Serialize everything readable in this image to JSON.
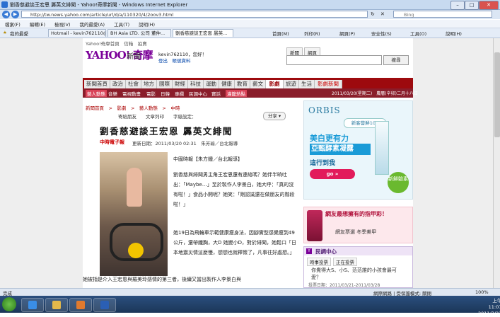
{
  "window": {
    "title": "劉香慈避談王宏恩 羼英文緋聞 - Yahoo!奇摩新聞 - Windows Internet Explorer",
    "min": "–",
    "max": "□",
    "close": "✕"
  },
  "address": {
    "url": "http://tw.news.yahoo.com/article/url/d/a/110320/4/2oov3.html",
    "search_placeholder": "Bing"
  },
  "menu": [
    "檔案(F)",
    "編輯(E)",
    "檢視(V)",
    "我的最愛(A)",
    "工具(T)",
    "說明(H)"
  ],
  "favbar": {
    "favorites": "我的最愛",
    "tabs": [
      "Hotmail - kevin762110@...",
      "BH Asia LTD. 公司 董仲...",
      "劉香慈避談王宏恩 羼英..."
    ],
    "commands": [
      "首頁(M)",
      "列印(R)",
      "網頁(P)",
      "安全性(S)",
      "工具(O)",
      "說明(H)"
    ]
  },
  "site": {
    "toplinks": "Yahoo!奇摩首頁　信箱　拍賣",
    "logo": "YAHOO! 奇摩",
    "logo_sub": "新聞",
    "user": "kevin762110，您好！",
    "user_links": "登出　帳號資料",
    "search_tabs": [
      "新聞",
      "網頁"
    ],
    "search_button": "搜尋"
  },
  "categories": [
    "新聞首頁",
    "政治",
    "社會",
    "地方",
    "國際",
    "財經",
    "科技",
    "運動",
    "健康",
    "教育",
    "藝文",
    "影劇",
    "旅遊",
    "生活",
    "影劇新聞"
  ],
  "subnav": {
    "items": [
      "藝人動態",
      "音樂",
      "電視動畫",
      "電影",
      "日韓",
      "專欄",
      "民調中心",
      "寶話",
      "灌籠熱點"
    ],
    "date": "2011/03/20(星期二)　農曆(辛卯)二月十八日"
  },
  "breadcrumb": "新聞首頁　>　影劇　>　藝人動態　>　中時",
  "tools": {
    "items": "寄給朋友　　文章列印　　字級設定：",
    "share": "分享 ▾"
  },
  "article": {
    "headline": "劉香慈避談王宏恩 羼英文緋聞",
    "source": "中時電子報",
    "dateline": "更新日期：2011/03/20 02:31　朱芳瑜／台北報導",
    "paragraphs": [
      "中國時報【朱方鍾／台北報導】",
      "劉香慈與緋聞男主角王宏恩還有連絡嗎？她伴半晌吐出：「Maybe…」至於製作人李景白，她大呼：「真的沒有啦！」食品小開呢？她笑：「剛認識還在做朋友的階段啦！」",
      "她19日為飛輪車示範健康瘦身法，因腳實型感覺瘦到49公斤，還帶纖胸，大D 她變小D，對於緋聞，她鬆口「日本地震災情這麼慢，想想也就釋懷了，凡事往好處想。」",
      "她被指是介入王宏恩與羅美玲感情的第三者，後續又當出製作人李景白與"
    ],
    "link_words": [
      "瘦身",
      "地震",
      "第三者"
    ]
  },
  "ads": {
    "brand": "ORBIS",
    "pill": "新客嘗鮮100",
    "line1": "美白更有力",
    "line2": "亞甄酵素凝露",
    "line3": "這行到我",
    "go": "go »",
    "badge": "新鮮驗素",
    "ad2_q": "網友最想擁有的指甲彩！",
    "ad2_l2": "網友票選 冬季美甲"
  },
  "poll": {
    "title": "民調中心",
    "tabs": [
      "時事投票",
      "正在投票"
    ],
    "question": "你覺得大S、小S、范范誰的小孩會最可愛？",
    "meta": "投票日期：2011/03/21-2011/03/28"
  },
  "status": {
    "left": "完成",
    "zone": "網際網路 | 受保護模式: 關閉",
    "zoom": "100%"
  },
  "clock": {
    "time": "上午 11:07",
    "date": "2011/3/22"
  }
}
